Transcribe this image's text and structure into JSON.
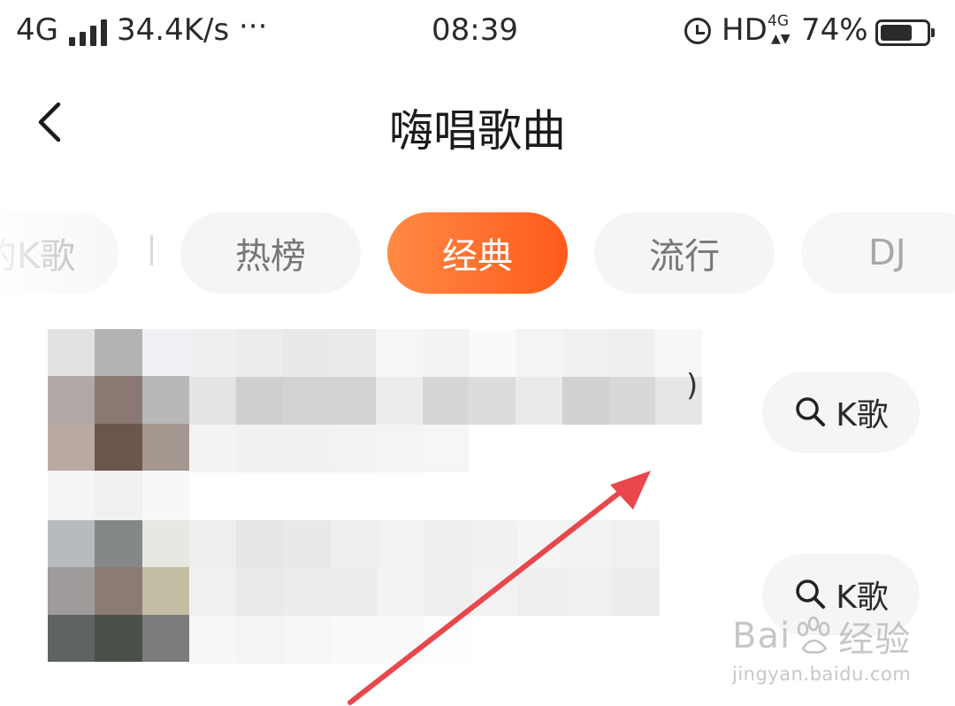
{
  "status_bar": {
    "network": "4G",
    "speed": "34.4K/s",
    "more": "···",
    "time": "08:39",
    "hd": "HD",
    "hd_sub": "4G",
    "battery_percent": "74%",
    "battery_level": 0.74,
    "icons": [
      "signal-icon",
      "alarm-icon",
      "battery-icon"
    ]
  },
  "header": {
    "title": "嗨唱歌曲",
    "back_icon": "chevron-left-icon"
  },
  "tabs": [
    {
      "label": "的K歌",
      "active": false
    },
    {
      "label": "热榜",
      "active": false
    },
    {
      "label": "经典",
      "active": true
    },
    {
      "label": "流行",
      "active": false
    },
    {
      "label": "DJ",
      "active": false
    }
  ],
  "colors": {
    "accent_start": "#ff8a45",
    "accent_end": "#ff5a1a",
    "annotation_arrow": "#e8474b"
  },
  "songs": [
    {
      "title_suffix": ")",
      "button_label": "K歌",
      "button_icon": "search-icon"
    },
    {
      "title_suffix": "",
      "button_label": "K歌",
      "button_icon": "search-icon"
    }
  ],
  "watermark": {
    "brand": "Bai",
    "brand_after_paw": "经验",
    "url": "jingyan.baidu.com"
  }
}
